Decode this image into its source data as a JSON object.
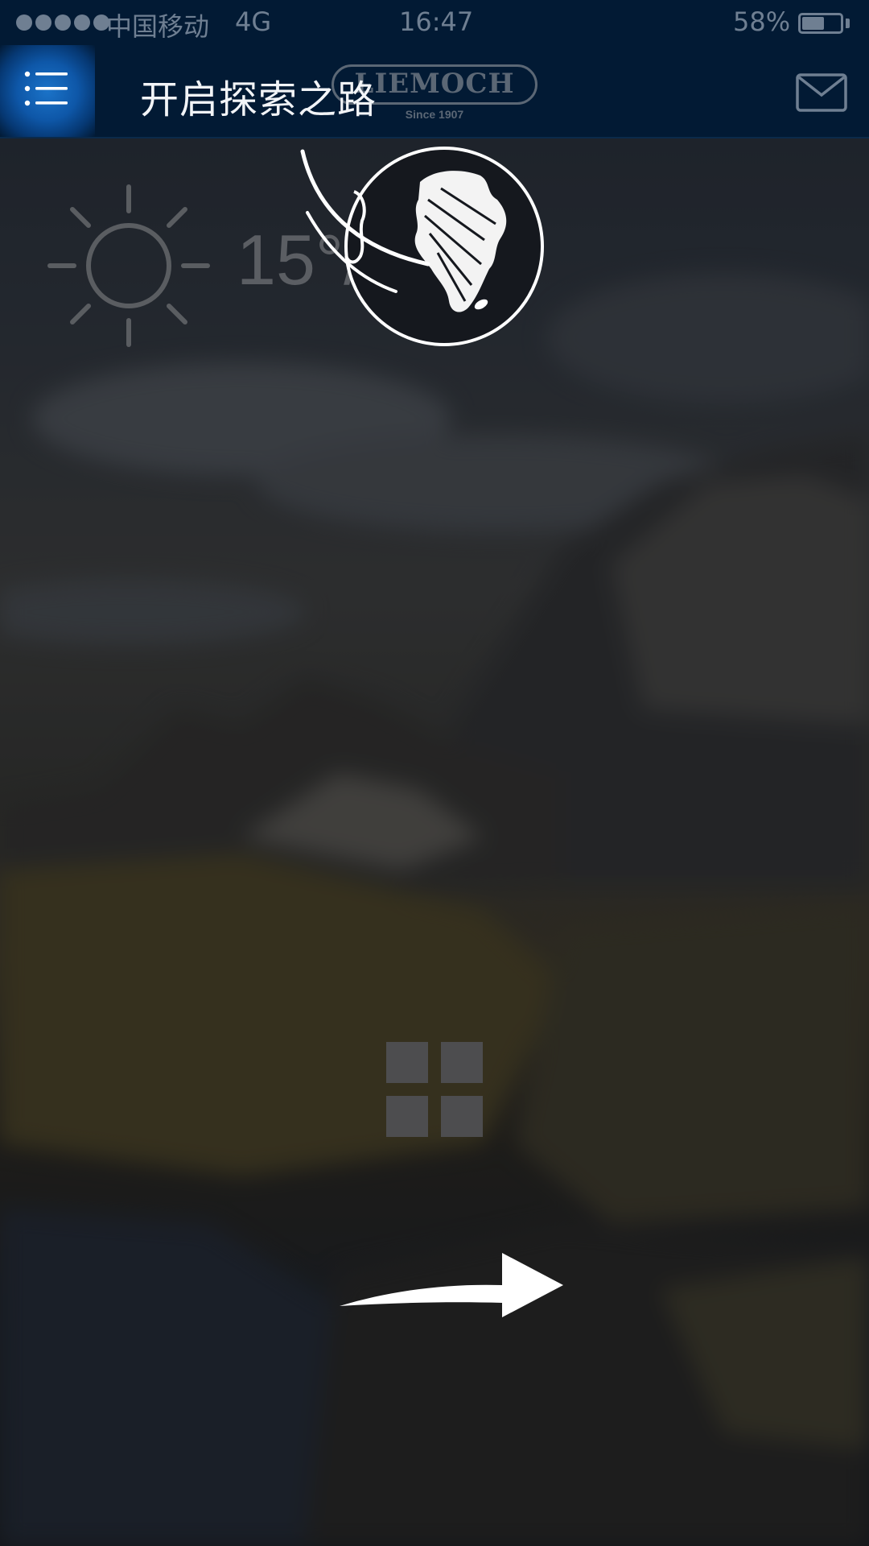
{
  "status_bar": {
    "carrier": "中国移动",
    "network": "4G",
    "time": "16:47",
    "battery_percent": "58%",
    "battery_level": 0.58
  },
  "nav": {
    "title": "开启探索之路",
    "logo_text": "LIEMOCH",
    "logo_subtitle": "Since 1907",
    "menu_icon": "menu-list-icon",
    "mail_icon": "mail-icon"
  },
  "weather": {
    "icon": "sun-icon",
    "temperature": "15°/23"
  },
  "overlay": {
    "globe_icon": "globe-icon",
    "apps_icon": "grid-icon",
    "arrow_icon": "arrow-right-icon"
  },
  "colors": {
    "bar_background": "#021a34",
    "menu_highlight": "#1b73c8",
    "title_text": "#f2f4f7",
    "muted": "#6f7f92"
  }
}
